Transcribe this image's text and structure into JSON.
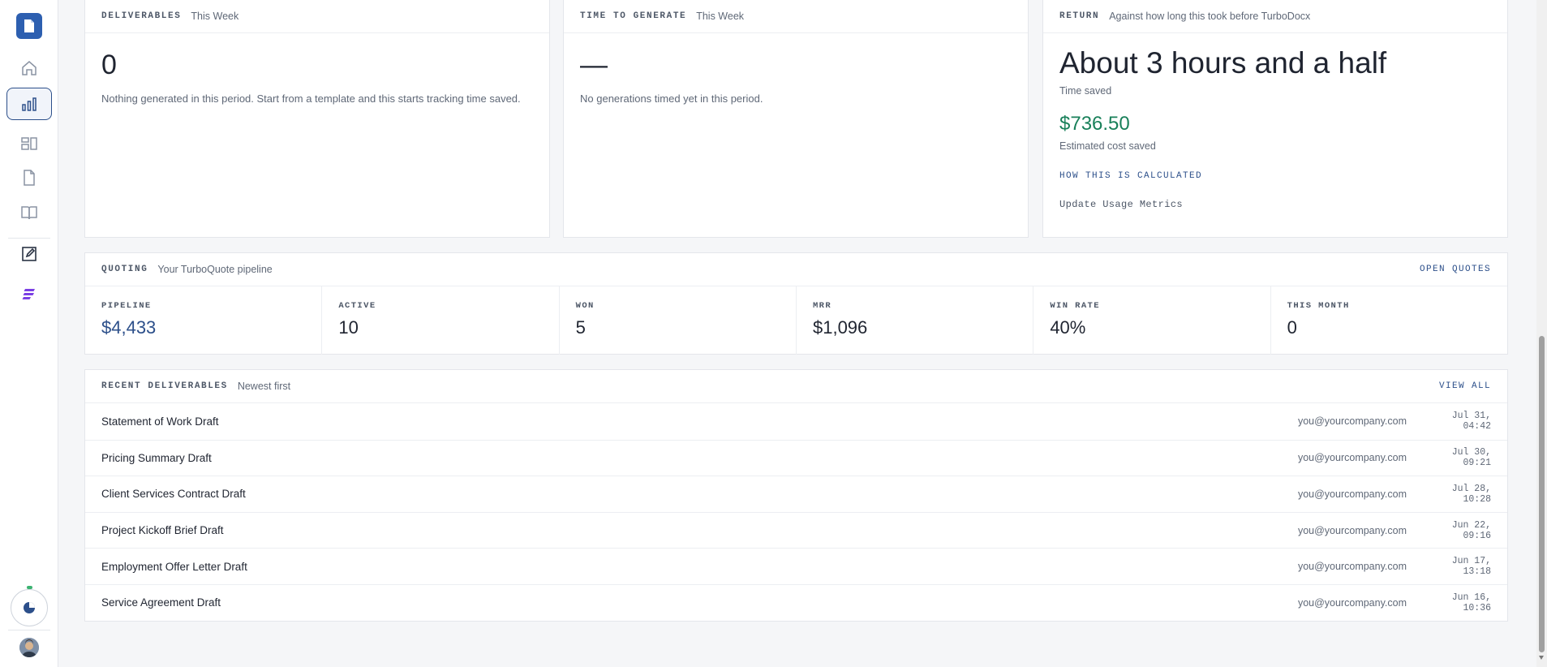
{
  "sidebar": {
    "items": [
      {
        "icon": "home-icon"
      },
      {
        "icon": "bar-chart-icon",
        "active": true
      },
      {
        "icon": "templates-icon"
      },
      {
        "icon": "document-icon"
      },
      {
        "icon": "book-icon"
      },
      {
        "icon": "edit-icon"
      },
      {
        "icon": "turboquote-icon"
      }
    ],
    "accent": "#2c4f8a"
  },
  "deliverables": {
    "eyebrow": "DELIVERABLES",
    "period": "This Week",
    "value": "0",
    "note": "Nothing generated in this period. Start from a template and this starts tracking time saved."
  },
  "time_to_generate": {
    "eyebrow": "TIME TO GENERATE",
    "period": "This Week",
    "value": "—",
    "note": "No generations timed yet in this period."
  },
  "return": {
    "eyebrow": "RETURN",
    "subtitle": "Against how long this took before TurboDocx",
    "time_saved": "About 3 hours and a half",
    "time_saved_label": "Time saved",
    "cost_saved": "$736.50",
    "cost_saved_label": "Estimated cost saved",
    "calc_link": "HOW THIS IS CALCULATED",
    "update_link": "Update Usage Metrics"
  },
  "quoting": {
    "eyebrow": "QUOTING",
    "subtitle": "Your TurboQuote pipeline",
    "open_link": "OPEN QUOTES",
    "stats": [
      {
        "label": "PIPELINE",
        "value": "$4,433"
      },
      {
        "label": "ACTIVE",
        "value": "10"
      },
      {
        "label": "WON",
        "value": "5"
      },
      {
        "label": "MRR",
        "value": "$1,096"
      },
      {
        "label": "WIN RATE",
        "value": "40%"
      },
      {
        "label": "THIS MONTH",
        "value": "0"
      }
    ]
  },
  "recent": {
    "eyebrow": "RECENT DELIVERABLES",
    "subtitle": "Newest first",
    "view_all": "VIEW ALL",
    "rows": [
      {
        "title": "Statement of Work Draft",
        "owner": "you@yourcompany.com",
        "time": "Jul 31, 04:42"
      },
      {
        "title": "Pricing Summary Draft",
        "owner": "you@yourcompany.com",
        "time": "Jul 30, 09:21"
      },
      {
        "title": "Client Services Contract Draft",
        "owner": "you@yourcompany.com",
        "time": "Jul 28, 10:28"
      },
      {
        "title": "Project Kickoff Brief Draft",
        "owner": "you@yourcompany.com",
        "time": "Jun 22, 09:16"
      },
      {
        "title": "Employment Offer Letter Draft",
        "owner": "you@yourcompany.com",
        "time": "Jun 17, 13:18"
      },
      {
        "title": "Service Agreement Draft",
        "owner": "you@yourcompany.com",
        "time": "Jun 16, 10:36"
      }
    ]
  }
}
